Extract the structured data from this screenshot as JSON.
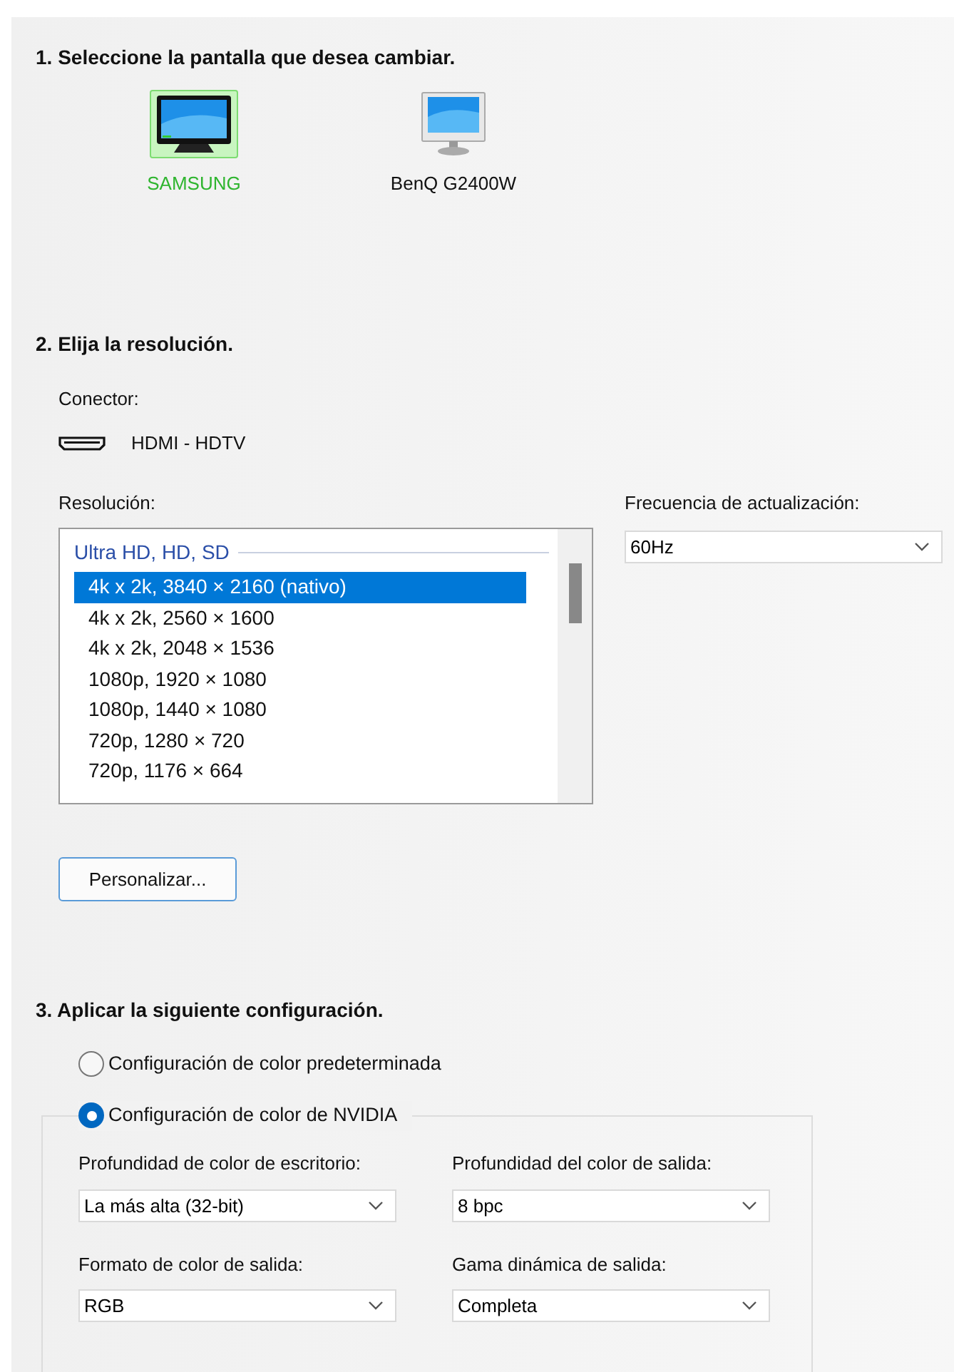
{
  "sections": [
    {
      "heading": "1. Seleccione la pantalla que desea cambiar."
    },
    {
      "heading": "2. Elija la resolución."
    },
    {
      "heading": "3. Aplicar la siguiente configuración."
    }
  ],
  "displays": [
    {
      "name": "SAMSUNG",
      "selected": true,
      "kind": "tv"
    },
    {
      "name": "BenQ G2400W",
      "selected": false,
      "kind": "monitor"
    }
  ],
  "connector": {
    "label": "Conector:",
    "value": "HDMI - HDTV"
  },
  "resolution": {
    "label": "Resolución:",
    "group": "Ultra HD, HD, SD",
    "items": [
      {
        "text": "4k x 2k, 3840 × 2160 (nativo)",
        "selected": true
      },
      {
        "text": "4k x 2k, 2560 × 1600",
        "selected": false
      },
      {
        "text": "4k x 2k, 2048 × 1536",
        "selected": false
      },
      {
        "text": "1080p, 1920 × 1080",
        "selected": false
      },
      {
        "text": "1080p, 1440 × 1080",
        "selected": false
      },
      {
        "text": "720p, 1280 × 720",
        "selected": false
      },
      {
        "text": "720p, 1176 × 664",
        "selected": false
      }
    ]
  },
  "refresh": {
    "label": "Frecuencia de actualización:",
    "value": "60Hz"
  },
  "customize_button": "Personalizar...",
  "color_options": [
    {
      "label": "Configuración de color predeterminada",
      "selected": false
    },
    {
      "label": "Configuración de color de NVIDIA",
      "selected": true
    }
  ],
  "nvidia_settings": [
    {
      "label": "Profundidad de color de escritorio:",
      "value": "La más alta (32-bit)"
    },
    {
      "label": "Profundidad del color de salida:",
      "value": "8 bpc"
    },
    {
      "label": "Formato de color de salida:",
      "value": "RGB"
    },
    {
      "label": "Gama dinámica de salida:",
      "value": "Completa"
    }
  ]
}
